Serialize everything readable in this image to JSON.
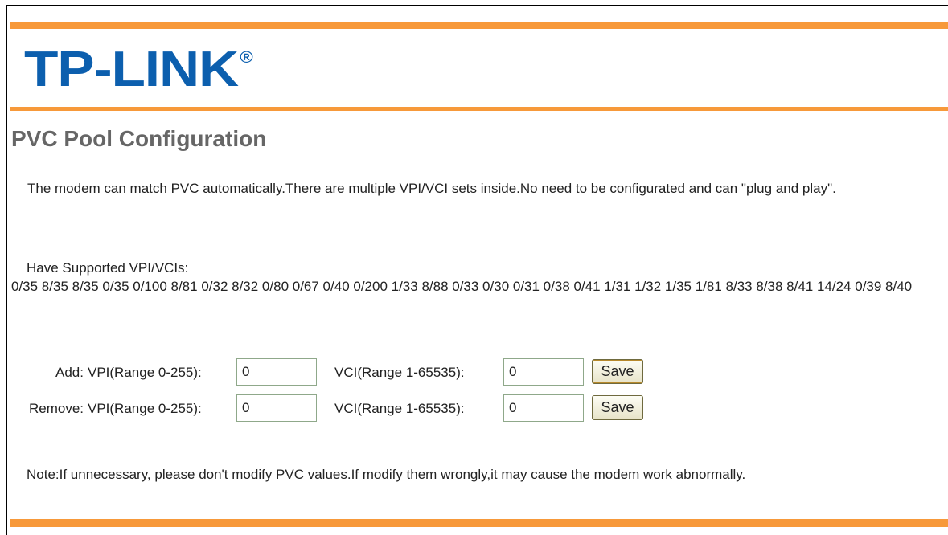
{
  "brand": {
    "logo_text": "TP-LINK",
    "registered_mark": "®",
    "colors": {
      "logo_blue": "#0c5fae",
      "accent_orange": "#f7993a"
    }
  },
  "page": {
    "title": "PVC Pool Configuration",
    "description": "The modem can match PVC automatically.There are multiple VPI/VCI sets inside.No need to be configurated and can \"plug and play\".",
    "supported_label": "Have Supported VPI/VCIs:",
    "supported_list": "0/35 8/35 8/35 0/35 0/100 8/81 0/32 8/32 0/80 0/67 0/40 0/200 1/33 8/88 0/33 0/30 0/31 0/38 0/41 1/31 1/32 1/35 1/81 8/33 8/38 8/41 14/24 0/39 8/40",
    "note": "Note:If unnecessary, please don't modify PVC values.If modify them wrongly,it may cause the modem work abnormally."
  },
  "form": {
    "add": {
      "label": "Add:",
      "vpi_label": "VPI(Range 0-255):",
      "vpi_value": "0",
      "vci_label": "VCI(Range 1-65535):",
      "vci_value": "0",
      "save_label": "Save"
    },
    "remove": {
      "label": "Remove:",
      "vpi_label": "VPI(Range 0-255):",
      "vpi_value": "0",
      "vci_label": "VCI(Range 1-65535):",
      "vci_value": "0",
      "save_label": "Save"
    }
  }
}
